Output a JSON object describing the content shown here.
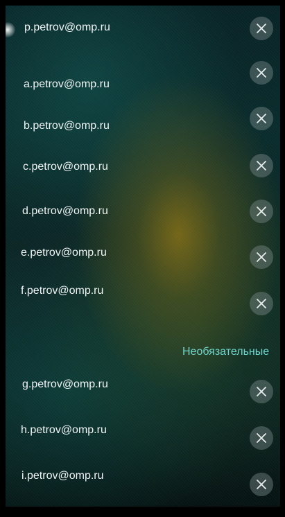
{
  "recipients": [
    {
      "email": "p.petrov@omp.ru"
    },
    {
      "email": "a.petrov@omp.ru"
    },
    {
      "email": "b.petrov@omp.ru"
    },
    {
      "email": "c.petrov@omp.ru"
    },
    {
      "email": "d.petrov@omp.ru"
    },
    {
      "email": "e.petrov@omp.ru"
    },
    {
      "email": "f.petrov@omp.ru"
    }
  ],
  "optional_section": {
    "header": "Необязательные",
    "recipients": [
      {
        "email": "g.petrov@omp.ru"
      },
      {
        "email": "h.petrov@omp.ru"
      },
      {
        "email": "i.petrov@omp.ru"
      }
    ]
  },
  "icons": {
    "remove": "close-icon"
  },
  "colors": {
    "section_header": "#6fd6cd",
    "text": "#f1f5f5"
  }
}
